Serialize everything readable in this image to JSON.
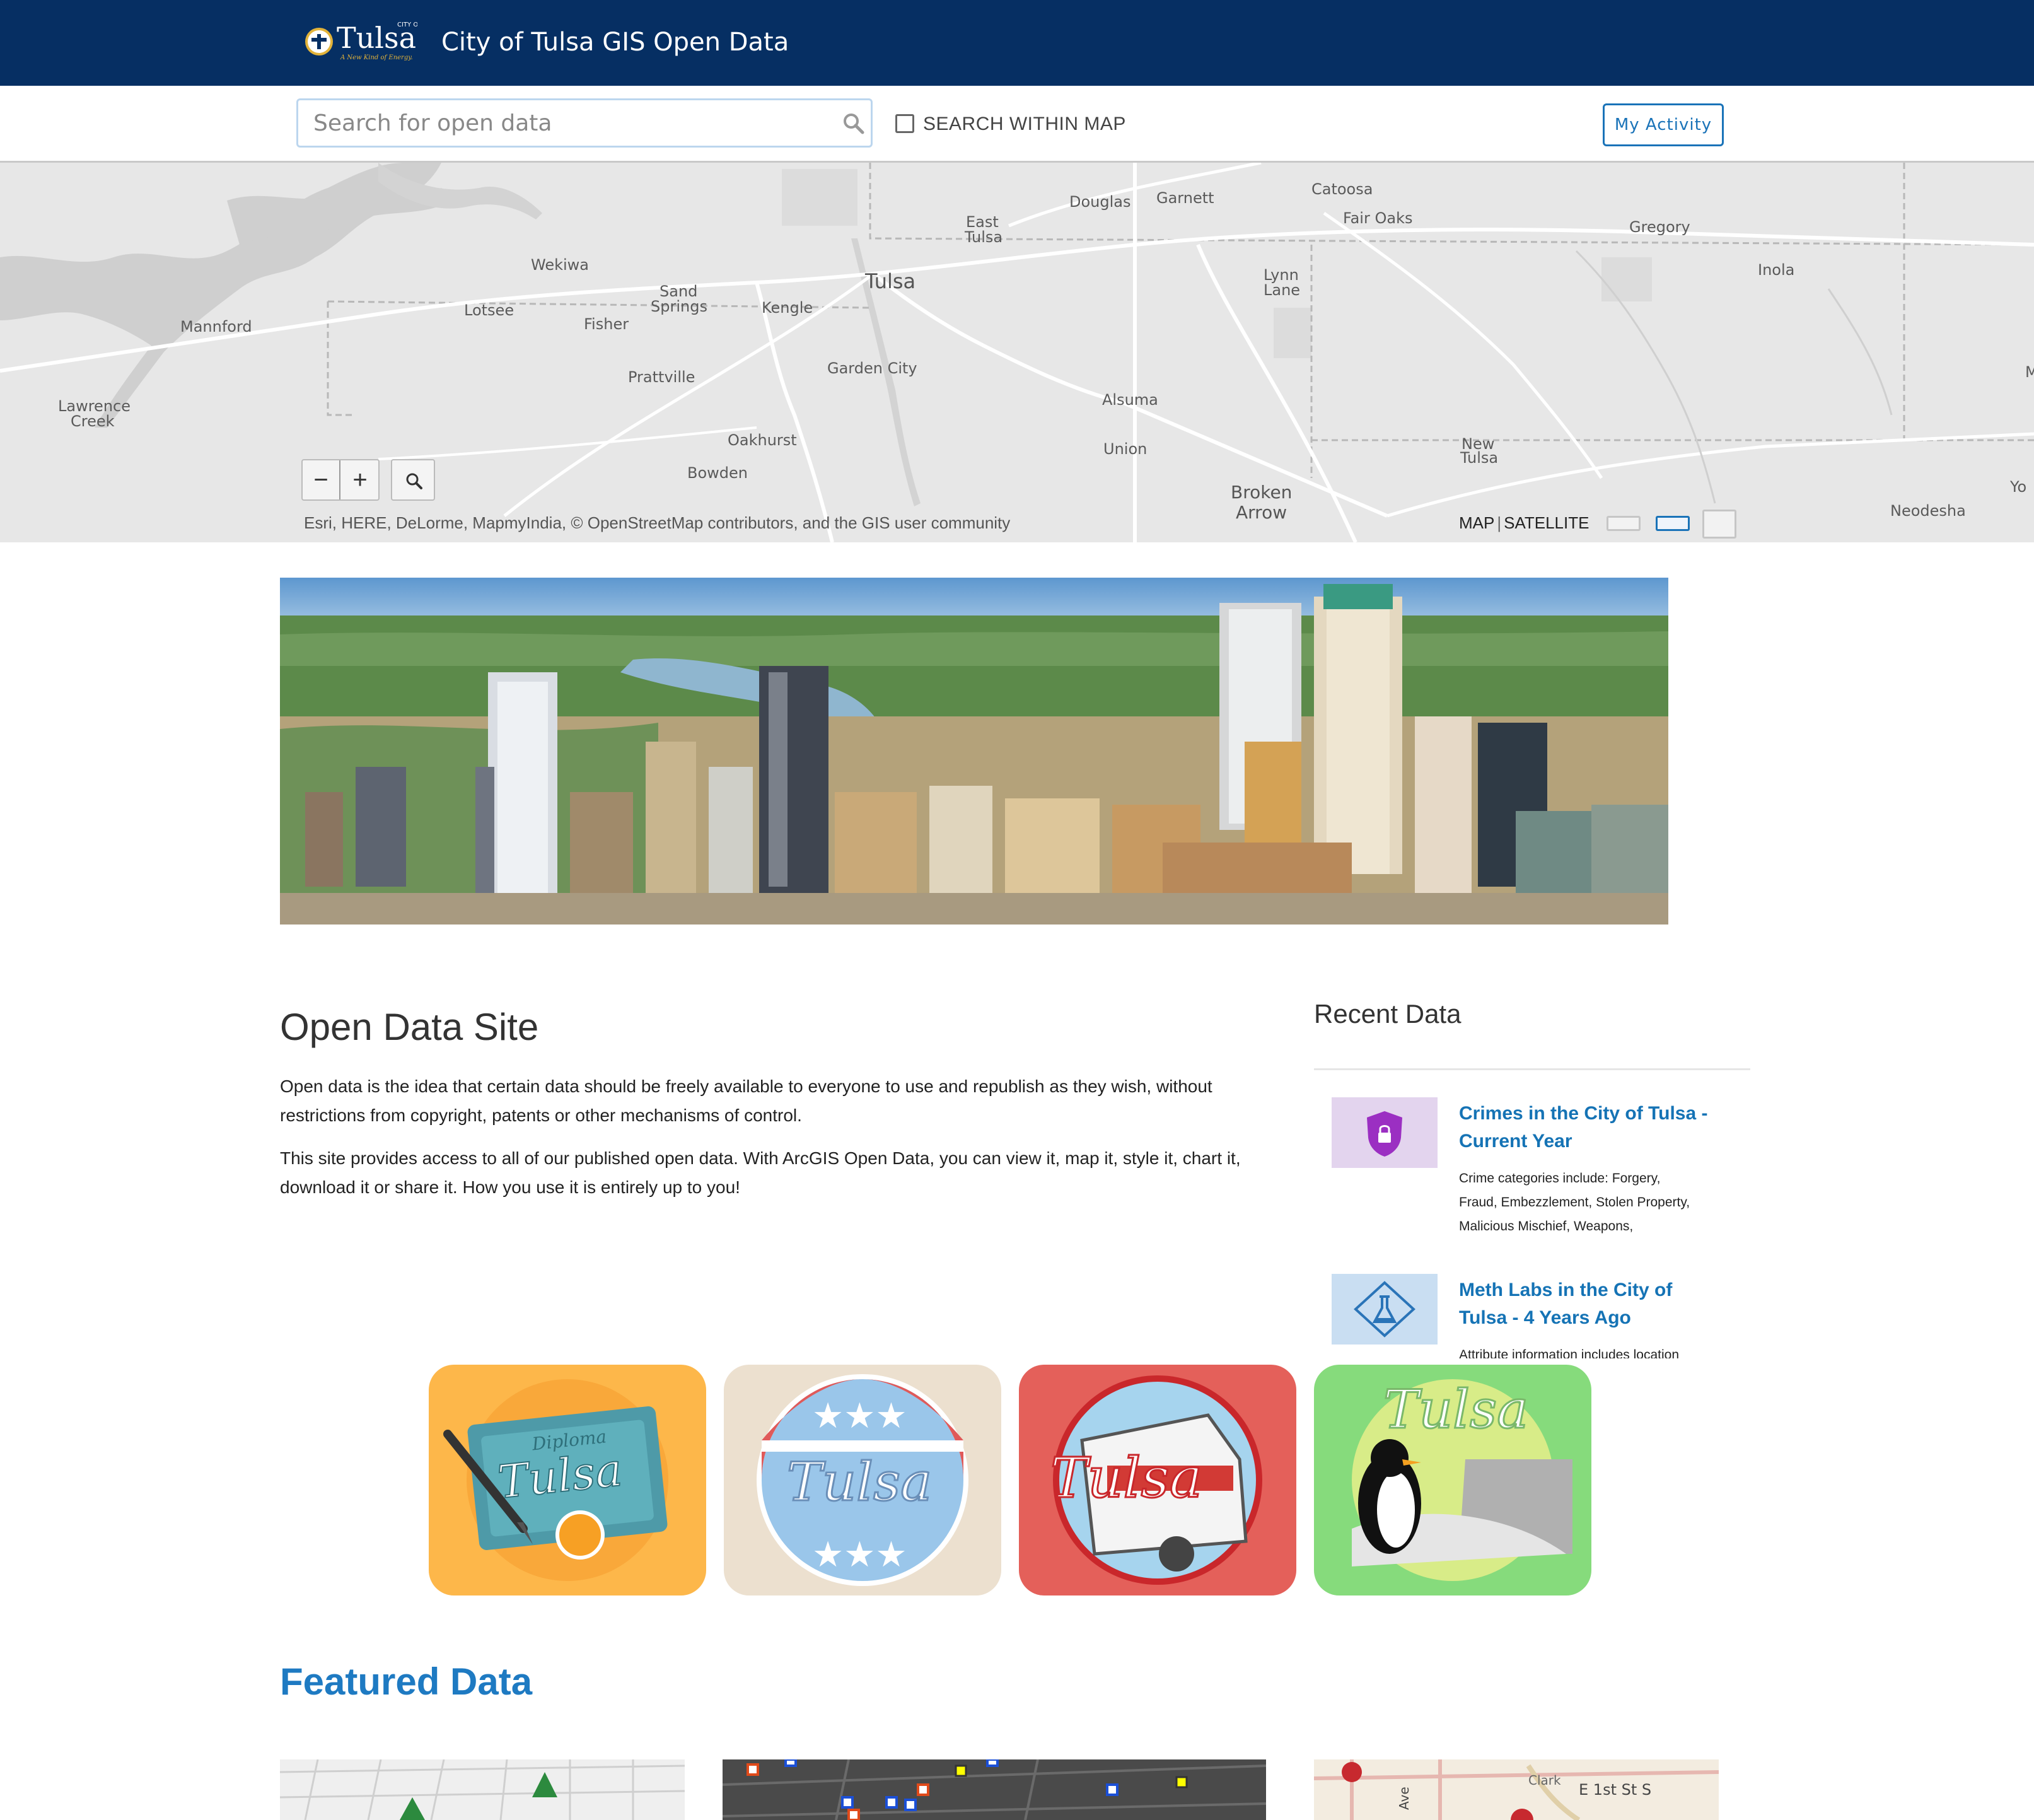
{
  "header": {
    "logo_label": "Tulsa",
    "logo_small_label": "CITY OF",
    "logo_tagline": "A New Kind of Energy.",
    "title": "City of Tulsa GIS Open Data"
  },
  "search": {
    "placeholder": "Search for open data",
    "within_map_label": "SEARCH WITHIN MAP",
    "activity_button": "My Activity"
  },
  "map": {
    "places": {
      "catoosa": "Catoosa",
      "fair_oaks": "Fair Oaks",
      "douglas": "Douglas",
      "garnett": "Garnett",
      "east_tulsa_1": "East",
      "east_tulsa_2": "Tulsa",
      "gregory": "Gregory",
      "inola": "Inola",
      "wekiwa": "Wekiwa",
      "sand_springs_1": "Sand",
      "sand_springs_2": "Springs",
      "tulsa": "Tulsa",
      "kengle": "Kengle",
      "lotsee": "Lotsee",
      "fisher": "Fisher",
      "lynn_lane_1": "Lynn",
      "lynn_lane_2": "Lane",
      "mannford": "Mannford",
      "prattville": "Prattville",
      "garden_city": "Garden City",
      "lawrence_creek_1": "Lawrence",
      "lawrence_creek_2": "Creek",
      "alsuma": "Alsuma",
      "oakhurst": "Oakhurst",
      "new_tulsa_1": "New",
      "new_tulsa_2": "Tulsa",
      "union": "Union",
      "bowden": "Bowden",
      "broken_arrow_1": "Broken",
      "broken_arrow_2": "Arrow",
      "neodesha": "Neodesha",
      "edge_right": "Yo",
      "edge_m": "M"
    },
    "zoom_out": "−",
    "zoom_in": "+",
    "attribution": "Esri, HERE, DeLorme, MapmyIndia, © OpenStreetMap contributors, and the GIS user community",
    "basemap_map": "MAP",
    "basemap_sep": "|",
    "basemap_satellite": "SATELLITE"
  },
  "content": {
    "title": "Open Data Site",
    "paragraph1_line1": "Open data is the idea that certain data should be freely available to everyone to use and republish as they wish, without",
    "paragraph1_line2": "restrictions from copyright, patents or other mechanisms of control.",
    "paragraph2_line1": "This site provides access to all of our published open data. With ArcGIS Open Data, you can view it, map it, style it, chart it,",
    "paragraph2_line2": "download it or share it. How you use it is entirely up to you!"
  },
  "recent": {
    "title": "Recent Data",
    "items": [
      {
        "title_line1": "Crimes in the City of Tulsa -",
        "title_line2": "Current Year",
        "desc_line1": "Crime categories include: Forgery,",
        "desc_line2": "Fraud, Embezzlement, Stolen Property,",
        "desc_line3": "Malicious Mischief, Weapons,"
      },
      {
        "title_line1": "Meth Labs in the City of",
        "title_line2": "Tulsa - 4 Years Ago",
        "desc_line1": "Attribute information includes location"
      }
    ]
  },
  "badges": {
    "diploma_word": "Diploma",
    "word": "Tulsa"
  },
  "featured": {
    "title": "Featured Data",
    "street_label_1": "E 1st St S",
    "street_label_2": "Clark",
    "street_label_3": "Ave"
  },
  "colors": {
    "header_bg": "#062f63",
    "link": "#1573b5",
    "featured_title": "#1e7ac2",
    "badge_orange": "#fdb74a",
    "badge_cream": "#ece0cf",
    "badge_red": "#e4605a",
    "badge_green": "#86db7c"
  }
}
